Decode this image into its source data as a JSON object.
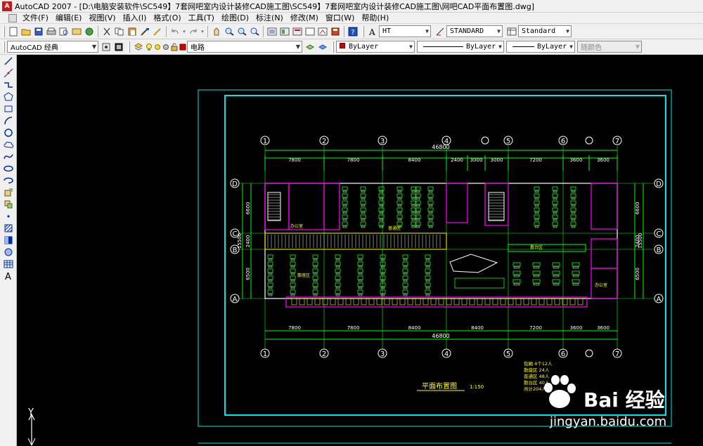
{
  "window": {
    "title": "AutoCAD 2007 - [D:\\电脑安装软件\\SC549】7套网吧室内设计装修CAD施工图\\SC549】7套网吧室内设计装修CAD施工图\\网吧CAD平面布置图.dwg]"
  },
  "menu": {
    "items": [
      "文件(F)",
      "编辑(E)",
      "视图(V)",
      "插入(I)",
      "格式(O)",
      "工具(T)",
      "绘图(D)",
      "标注(N)",
      "修改(M)",
      "窗口(W)",
      "帮助(H)"
    ]
  },
  "toolbar": {
    "text_style": "HT",
    "dim_style": "STANDARD",
    "table_style": "Standard",
    "workspace": "AutoCAD 经典",
    "layer": "电路",
    "color": "ByLayer",
    "linetype": "ByLayer",
    "lineweight": "ByLayer",
    "plotstyle": "随颜色"
  },
  "drawing": {
    "title": "平面布置图",
    "scale": "1:150",
    "total_dim": "46800",
    "top_dims": [
      "7800",
      "7800",
      "8400",
      "2400",
      "3000",
      "3000",
      "7200",
      "3600",
      "3600"
    ],
    "bottom_dims": [
      "7800",
      "7800",
      "8400",
      "8400",
      "7200",
      "3600",
      "3600"
    ],
    "axis_numbers": [
      "1",
      "2",
      "3",
      "4",
      "5",
      "6",
      "7"
    ],
    "axis_letters": [
      "D",
      "C",
      "B",
      "A"
    ],
    "left_dims": [
      "6600",
      "2400",
      "6500"
    ],
    "side_total": "15500",
    "legend": [
      "包厢  4个12人",
      "散座区  24人",
      "普通区  48人",
      "散台区  40人",
      "共计204人"
    ]
  },
  "ucs": {
    "y_label": "Y"
  },
  "watermark": {
    "brand": "Bai 经验",
    "url": "jingyan.baidu.com"
  },
  "colors": {
    "canvas": "#000000",
    "cyan": "#00e6e6",
    "green": "#00ff00",
    "yellow": "#ffff00",
    "magenta": "#ff00ff",
    "white": "#ffffff"
  }
}
